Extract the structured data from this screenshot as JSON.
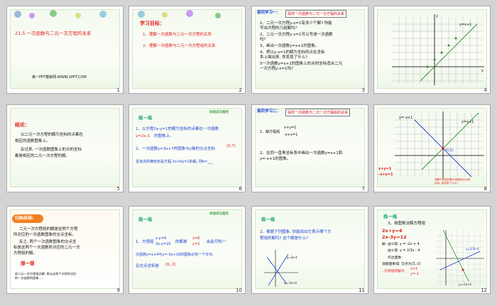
{
  "slides": [
    {
      "num": "1",
      "title": "21.5 一次函数与二元一次方程的关系",
      "footer": "第一PPT模板网-WWW.1PPT.COM"
    },
    {
      "num": "2",
      "heading": "学习目标：",
      "items": [
        "1、理解一次函数与二元一次方程的关系",
        "2、理解一次函数与二元一次方程组的关系"
      ]
    },
    {
      "num": "3",
      "header": "探究学习一：",
      "header_box": "探究一次函数与二元一次方程的关系",
      "lines": [
        "1、二元一次方程y-x=1有多少个解? 你能",
        "写出方程的几组解吗?",
        "2、二元一次方程y-x=1可以写成一次函数",
        "吗?",
        "3、画出一次函数y=x+1的图象。",
        "4、把以y-x=1的解为坐标的点在坐标",
        "系上描出来, 你发现了什么?",
        "5一次函数y=x+1的图象上的点的坐标适合二元",
        "一次方程y-x=1吗?"
      ]
    },
    {
      "num": "4",
      "graph_label": "y=x+1",
      "axis_x": "x",
      "axis_y": "y"
    },
    {
      "num": "5",
      "heading": "结论：",
      "lines": [
        "以二元一次方程的解为坐标的点都在",
        "相应的函数图象上。",
        "反过来, 一次函数图象上的点的坐标",
        "都是相应的二元一次方程的解。"
      ]
    },
    {
      "num": "6",
      "heading": "练一练",
      "tag": "体验成功喜悦",
      "lines": [
        "1、以方程2x-y=1的解为坐标的点都在一次函数",
        "y=2x-1",
        "的图象上。",
        "2、一次函数y=3x+7的图象与y轴的交点坐标",
        "(0,7)",
        "且该点的横坐标是方程-2x+6y=1的解, 则b=___"
      ]
    },
    {
      "num": "7",
      "header": "探究学习二：",
      "header_box": "探究一次函数与二元一次方程组的关系",
      "sys_label": "1、解方程组",
      "sys": [
        "x+y=1",
        "-x+y=1"
      ],
      "line2": "2、在同一直角坐标系中画出一次函数y=x+1和",
      "line3": "y=-x+1的图象。"
    },
    {
      "num": "8",
      "label_top": "y=-x+1",
      "label_right": "y=x+1",
      "point": "(0,1)",
      "sys": [
        "x+y=1",
        "-x+y=1"
      ],
      "note": [
        "观察方程组的解与两直线交点的",
        "坐标, 你发现了什么?"
      ]
    },
    {
      "num": "9",
      "heading": "归纳总结:",
      "lines": [
        "二元一次方程组的解是这两个方程",
        "所对应的一次函数图象的交点坐标。",
        "反之, 两个一次函数图象的交点坐",
        "标是这两个一次函数所对应的二元一次",
        "方程组的解。"
      ],
      "think": "想一想",
      "think_line": "若二元一次方程组无解, 那么这两个方程所对应",
      "think_line2": "的一次函数的图象……"
    },
    {
      "num": "10",
      "heading": "练一练",
      "tag": "体验成功喜悦",
      "lines": [
        "1、方程组",
        "的解是",
        "由此可知一",
        "次函数y=x+4与y=-3x+16的图象必有一个交点,",
        "且交点坐标是"
      ],
      "sys": [
        "x-y=4",
        "3x-y=16"
      ],
      "sol": [
        "x=6",
        "y=2"
      ],
      "coord": "(6, 2)"
    },
    {
      "num": "11",
      "heading": "练一练",
      "lines": [
        "2、根据下列图象, 你能说出它表示哪个方",
        "程组的解吗? 这个解是什么?"
      ],
      "lbl1": "y=2x-4",
      "lbl2": "y=-3x+4"
    },
    {
      "num": "12",
      "heading": "练一练",
      "line": "3、用图象法解方程组",
      "sys": [
        "2x+y=4",
        "2x-3y=12"
      ],
      "steps": [
        "解: 由①得: y = -2x + 4",
        "由②得: y = 2/3x - 4",
        "作出图象:",
        "观察图象得: 交点为(3,-2)",
        "∴方程组的解为"
      ],
      "sol": [
        "x=3",
        "y=-2"
      ],
      "lbl1": "y=2/3x-4",
      "lbl2": "y=-2x+4"
    }
  ]
}
